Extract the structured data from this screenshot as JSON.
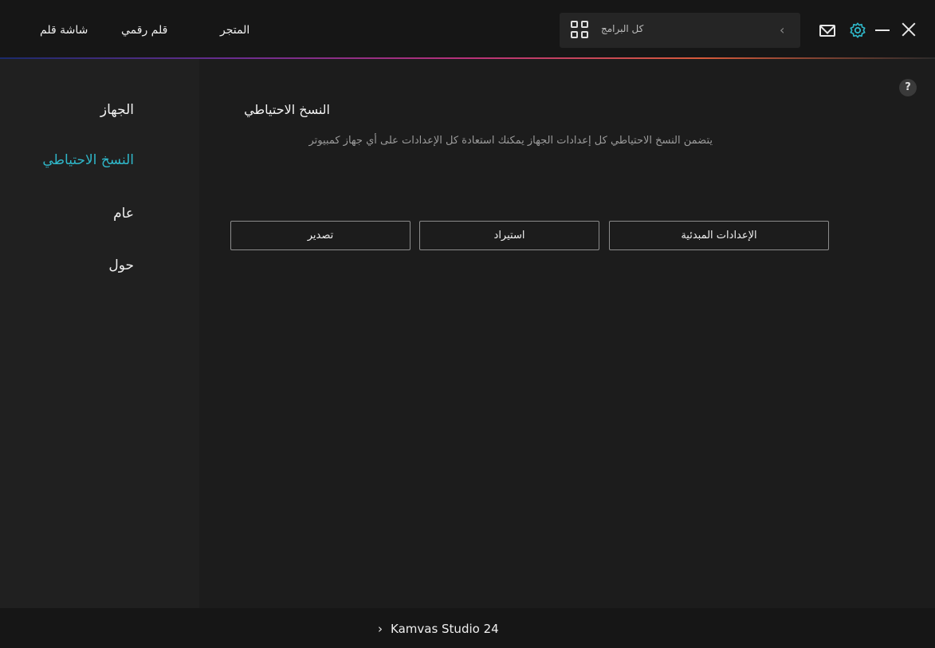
{
  "header": {
    "nav": {
      "pen_display": "شاشة قلم",
      "pen_tablet": "قلم رقمي",
      "store": "المتجر"
    },
    "search": {
      "label": "كل البرامج",
      "grid_icon": "grid-icon",
      "chevron": "‹"
    },
    "controls": {
      "mail_icon": "mail-icon",
      "settings_icon": "gear-icon",
      "minimize_icon": "minimize-icon",
      "close_icon": "close-icon"
    },
    "accent_gradient": [
      "#1b2a6b",
      "#6a2d8f",
      "#b8327a",
      "#d65a3a"
    ]
  },
  "sidebar": {
    "items": [
      {
        "label": "الجهاز",
        "active": false
      },
      {
        "label": "النسخ الاحتياطي",
        "active": true
      },
      {
        "label": "عام",
        "active": false
      },
      {
        "label": "حول",
        "active": false
      }
    ],
    "active_color": "#2fb7c9"
  },
  "main": {
    "help": "?",
    "backup": {
      "title": "النسخ الاحتياطي",
      "description": "يتضمن النسخ الاحتياطي كل إعدادات الجهاز يمكنك استعادة كل الإعدادات على أي جهاز كمبيوتر",
      "buttons": {
        "reset": "الإعدادات المبدئية",
        "import": "استيراد",
        "export": "تصدير"
      }
    }
  },
  "footer": {
    "device_chevron": "›",
    "device_name": "Kamvas Studio 24"
  }
}
